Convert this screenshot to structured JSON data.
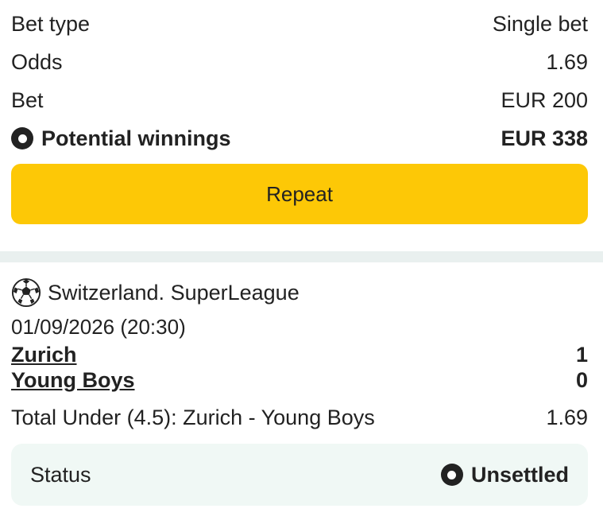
{
  "bet_summary": {
    "bet_type_label": "Bet type",
    "bet_type_value": "Single bet",
    "odds_label": "Odds",
    "odds_value": "1.69",
    "bet_label": "Bet",
    "bet_value": "EUR 200",
    "winnings_label": "Potential winnings",
    "winnings_value": "EUR 338",
    "repeat_label": "Repeat",
    "accent_color": "#fdc806"
  },
  "event": {
    "sport_icon": "soccer-ball-icon",
    "league": "Switzerland. SuperLeague",
    "datetime": "01/09/2026 (20:30)",
    "home_team": "Zurich",
    "home_score": "1",
    "away_team": "Young Boys",
    "away_score": "0",
    "market": "Total Under (4.5): Zurich - Young Boys",
    "market_odds": "1.69",
    "status_label": "Status",
    "status_value": "Unsettled"
  }
}
